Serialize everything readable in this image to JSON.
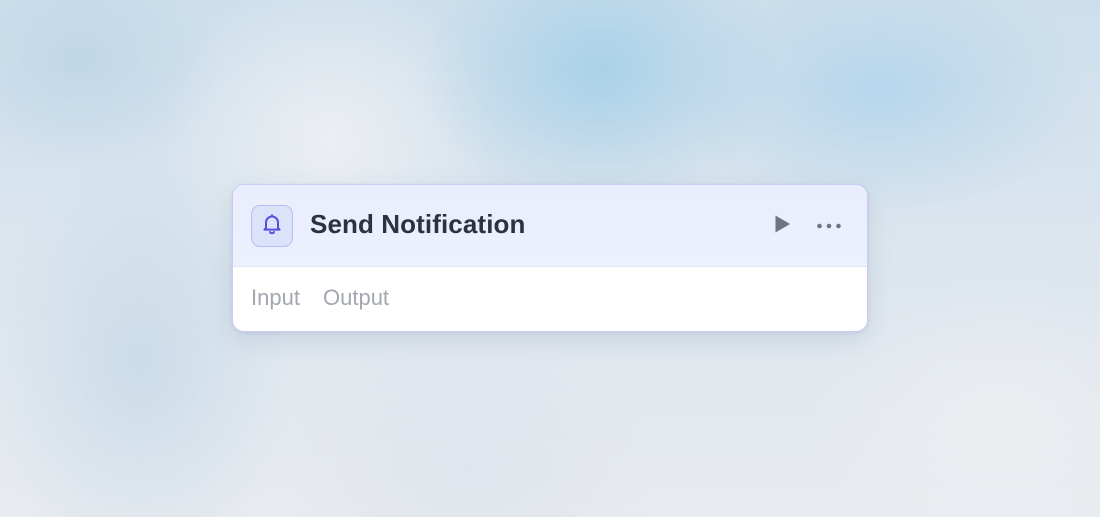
{
  "node": {
    "title": "Send Notification",
    "icon": "bell-icon",
    "actions": {
      "run_icon": "play-icon",
      "more_icon": "more-horizontal-icon"
    },
    "tabs": [
      {
        "label": "Input"
      },
      {
        "label": "Output"
      }
    ]
  },
  "colors": {
    "accent": "#5b4fe0",
    "header_background": "#ebeefd",
    "card_border": "#c6ccf6",
    "title_text": "#2d3240",
    "muted_text": "#a3a7b0",
    "action_icon": "#6e7380"
  }
}
